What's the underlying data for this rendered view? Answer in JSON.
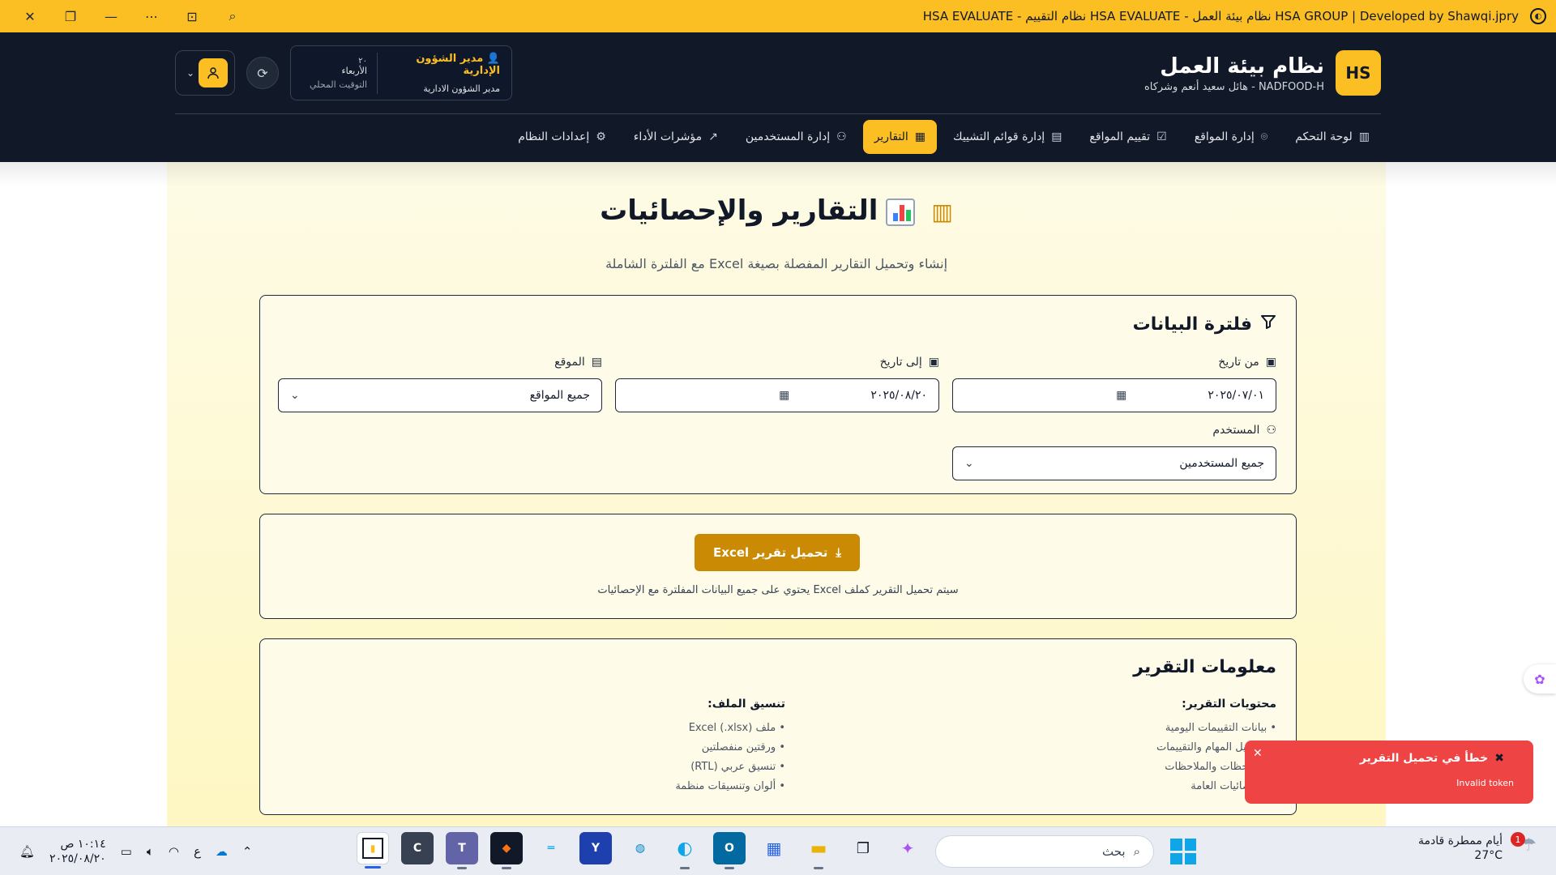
{
  "window": {
    "title": "HSA GROUP | Developed by Shawqi.jpry نظام بيئة العمل - HSA EVALUATE نظام التقييم - HSA EVALUATE"
  },
  "brand": {
    "logo": "HS",
    "name": "نظام بيئة العمل",
    "subtitle": "NADFOOD-H - هائل سعيد أنعم وشركاه"
  },
  "header_info": {
    "role_title": "مدير الشؤون الإدارية",
    "role_sub": "مدير الشؤون الادارية",
    "time_a": "٢٠",
    "time_b": "الأربعاء",
    "time_c": "التوقيت المحلي"
  },
  "nav": {
    "items": [
      {
        "label": "لوحة التحكم",
        "icon": "bar-chart-icon"
      },
      {
        "label": "إدارة المواقع",
        "icon": "map-pin-icon"
      },
      {
        "label": "تقييم المواقع",
        "icon": "check-square-icon"
      },
      {
        "label": "إدارة قوائم التشييك",
        "icon": "clipboard-icon"
      },
      {
        "label": "التقارير",
        "icon": "file-text-icon"
      },
      {
        "label": "إدارة المستخدمين",
        "icon": "users-icon"
      },
      {
        "label": "مؤشرات الأداء",
        "icon": "trending-up-icon"
      },
      {
        "label": "إعدادات النظام",
        "icon": "gear-icon"
      }
    ],
    "active_index": 4
  },
  "page": {
    "title": "التقارير والإحصائيات",
    "subtitle": "إنشاء وتحميل التقارير المفصلة بصيغة Excel مع الفلترة الشاملة"
  },
  "filter": {
    "title": "فلترة البيانات",
    "from_label": "من تاريخ",
    "from_value": "٢٠٢٥/٠٧/٠١",
    "to_label": "إلى تاريخ",
    "to_value": "٢٠٢٥/٠٨/٢٠",
    "site_label": "الموقع",
    "site_value": "جميع المواقع",
    "user_label": "المستخدم",
    "user_value": "جميع المستخدمين"
  },
  "download": {
    "button": "تحميل تقرير Excel",
    "note": "سيتم تحميل التقرير كملف Excel يحتوي على جميع البيانات المفلترة مع الإحصائيات"
  },
  "report_info": {
    "title": "معلومات التقرير",
    "contents_title": "محتويات التقرير:",
    "contents": [
      "• بيانات التقييمات اليومية",
      "• تفاصيل المهام والتقييمات",
      "• الملاحظات والملاحظات",
      "• الإحصائيات العامة"
    ],
    "format_title": "تنسيق الملف:",
    "format": [
      "• ملف Excel (.xlsx)",
      "• ورقتين منفصلتين",
      "• تنسيق عربي (RTL)",
      "• ألوان وتنسيقات منظمة"
    ]
  },
  "toast": {
    "title": "خطأ في تحميل التقرير",
    "message": "Invalid token"
  },
  "taskbar": {
    "time": "١٠:١٤ ص",
    "date": "٢٠٢٥/٠٨/٢٠",
    "lang": "ع",
    "search_placeholder": "بحث",
    "weather_title": "أيام ممطرة قادمة",
    "weather_temp": "27°C",
    "weather_badge": "1",
    "apps": [
      "C"
    ]
  },
  "colors": {
    "accent": "#fbbf24",
    "header_bg": "#111827",
    "button": "#ca8a04",
    "toast": "#ef4444"
  }
}
